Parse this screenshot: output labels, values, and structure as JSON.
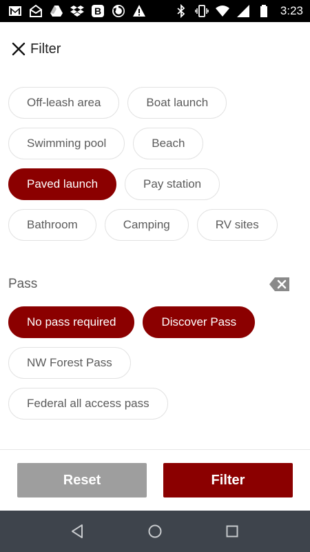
{
  "status_bar": {
    "time": "3:23",
    "left_icons": [
      "gmail-icon",
      "mail-open-icon",
      "drive-icon",
      "dropbox-icon",
      "b-app-icon",
      "sync-icon",
      "warning-icon"
    ],
    "right_icons": [
      "bluetooth-icon",
      "vibrate-icon",
      "wifi-icon",
      "signal-icon",
      "battery-icon"
    ]
  },
  "header": {
    "title": "Filter",
    "close_icon": "close-icon"
  },
  "amenities": [
    {
      "label": "Off-leash area",
      "selected": false
    },
    {
      "label": "Boat launch",
      "selected": false
    },
    {
      "label": "Swimming pool",
      "selected": false
    },
    {
      "label": "Beach",
      "selected": false
    },
    {
      "label": "Paved launch",
      "selected": true
    },
    {
      "label": "Pay station",
      "selected": false
    },
    {
      "label": "Bathroom",
      "selected": false
    },
    {
      "label": "Camping",
      "selected": false
    },
    {
      "label": "RV sites",
      "selected": false
    }
  ],
  "pass_section": {
    "label": "Pass",
    "clear_icon": "backspace-clear-icon",
    "options": [
      {
        "label": "No pass required",
        "selected": true
      },
      {
        "label": "Discover Pass",
        "selected": true
      },
      {
        "label": "NW Forest Pass",
        "selected": false
      },
      {
        "label": "Federal all access pass",
        "selected": false
      }
    ]
  },
  "buttons": {
    "reset_label": "Reset",
    "filter_label": "Filter"
  },
  "nav_bar": {
    "icons": [
      "back-triangle-icon",
      "home-circle-icon",
      "recents-square-icon"
    ]
  },
  "colors": {
    "accent": "#8b0000",
    "chip_text": "#5b5b5b",
    "reset_bg": "#9e9e9e",
    "nav_bg": "#3e444c"
  }
}
